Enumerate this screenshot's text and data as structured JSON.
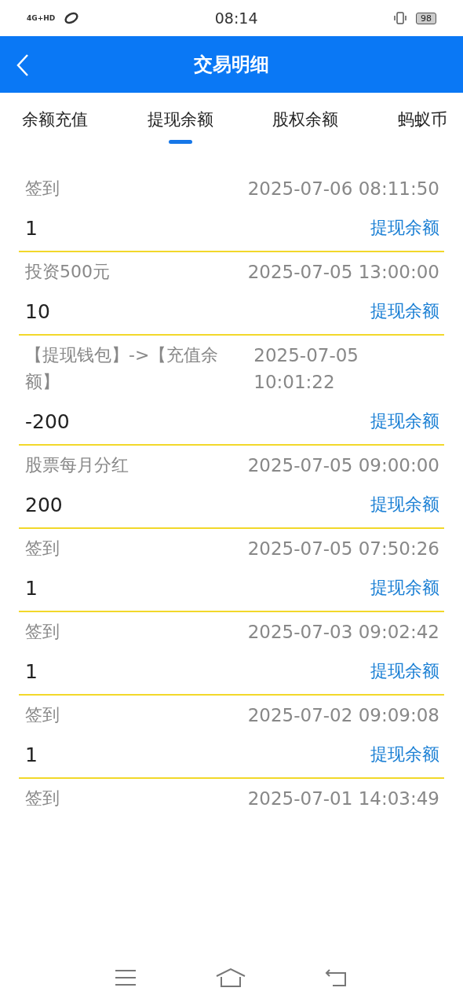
{
  "status_bar": {
    "network": "4G+HD",
    "time": "08:14",
    "battery": "98"
  },
  "header": {
    "title": "交易明细"
  },
  "tabs": [
    {
      "label": "余额充值",
      "selected": false
    },
    {
      "label": "提现余额",
      "selected": true
    },
    {
      "label": "股权余额",
      "selected": false
    },
    {
      "label": "蚂蚁币",
      "selected": false
    }
  ],
  "records": [
    {
      "title": "签到",
      "time": "2025-07-06 08:11:50",
      "amount": "1",
      "account": "提现余额"
    },
    {
      "title": "投资500元",
      "time": "2025-07-05 13:00:00",
      "amount": "10",
      "account": "提现余额"
    },
    {
      "title": "【提现钱包】->【充值余额】",
      "time": "2025-07-05 10:01:22",
      "amount": "-200",
      "account": "提现余额"
    },
    {
      "title": "股票每月分红",
      "time": "2025-07-05 09:00:00",
      "amount": "200",
      "account": "提现余额"
    },
    {
      "title": "签到",
      "time": "2025-07-05 07:50:26",
      "amount": "1",
      "account": "提现余额"
    },
    {
      "title": "签到",
      "time": "2025-07-03 09:02:42",
      "amount": "1",
      "account": "提现余额"
    },
    {
      "title": "签到",
      "time": "2025-07-02 09:09:08",
      "amount": "1",
      "account": "提现余额"
    },
    {
      "title": "签到",
      "time": "2025-07-01 14:03:49"
    }
  ]
}
